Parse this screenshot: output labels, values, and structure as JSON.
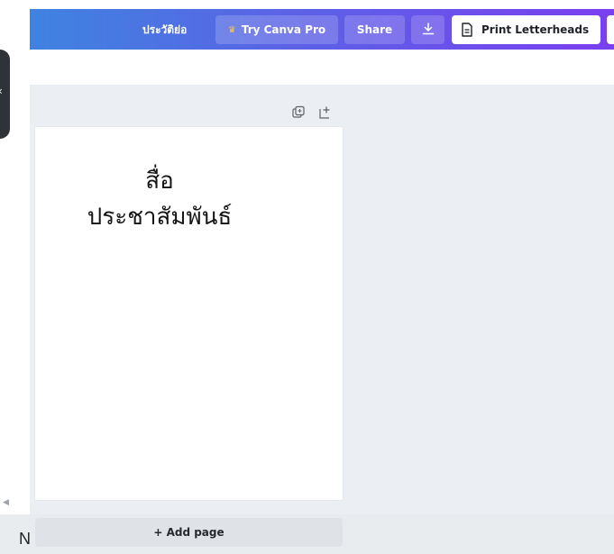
{
  "toolbar": {
    "title": "ประวัติย่อ",
    "try_pro_label": "Try Canva Pro",
    "share_label": "Share",
    "print_label": "Print Letterheads",
    "icons": {
      "download": "download-icon",
      "print": "document-icon",
      "pro": "crown-icon"
    }
  },
  "side": {
    "handle_glyph": "‹",
    "scroll_glyph": "◀",
    "bottom_letter": "N"
  },
  "page_icons": [
    "duplicate-page-icon",
    "add-page-icon"
  ],
  "canvas": {
    "line1": "สื่อ",
    "line2": "ประชาสัมพันธ์"
  },
  "add_page_label": "+ Add page",
  "colors": {
    "gradient_start": "#3f83e0",
    "gradient_end": "#7a3ff0",
    "workspace": "#ebeef2",
    "page": "#ffffff"
  }
}
